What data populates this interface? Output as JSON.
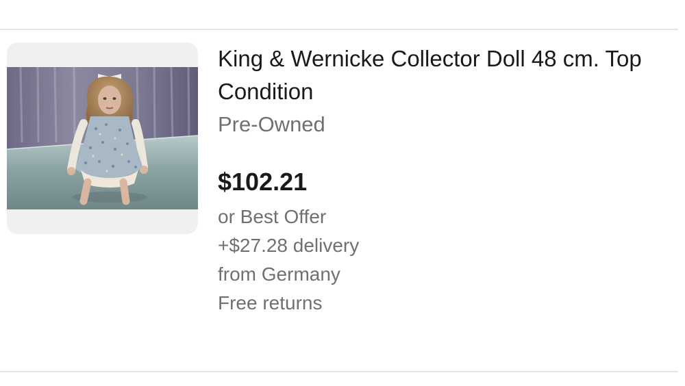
{
  "listing": {
    "title": "King & Wernicke Collector Doll 48 cm. Top Condition",
    "condition": "Pre-Owned",
    "price": "$102.21",
    "best_offer": "or Best Offer",
    "delivery": "+$27.28 delivery",
    "origin": "from Germany",
    "returns": "Free returns",
    "image": {
      "description": "doll photo",
      "icon": "product-photo"
    }
  },
  "colors": {
    "text_primary": "#191919",
    "text_secondary": "#707070",
    "divider": "#e5e5e5",
    "thumb_background": "#f0f0f0"
  }
}
